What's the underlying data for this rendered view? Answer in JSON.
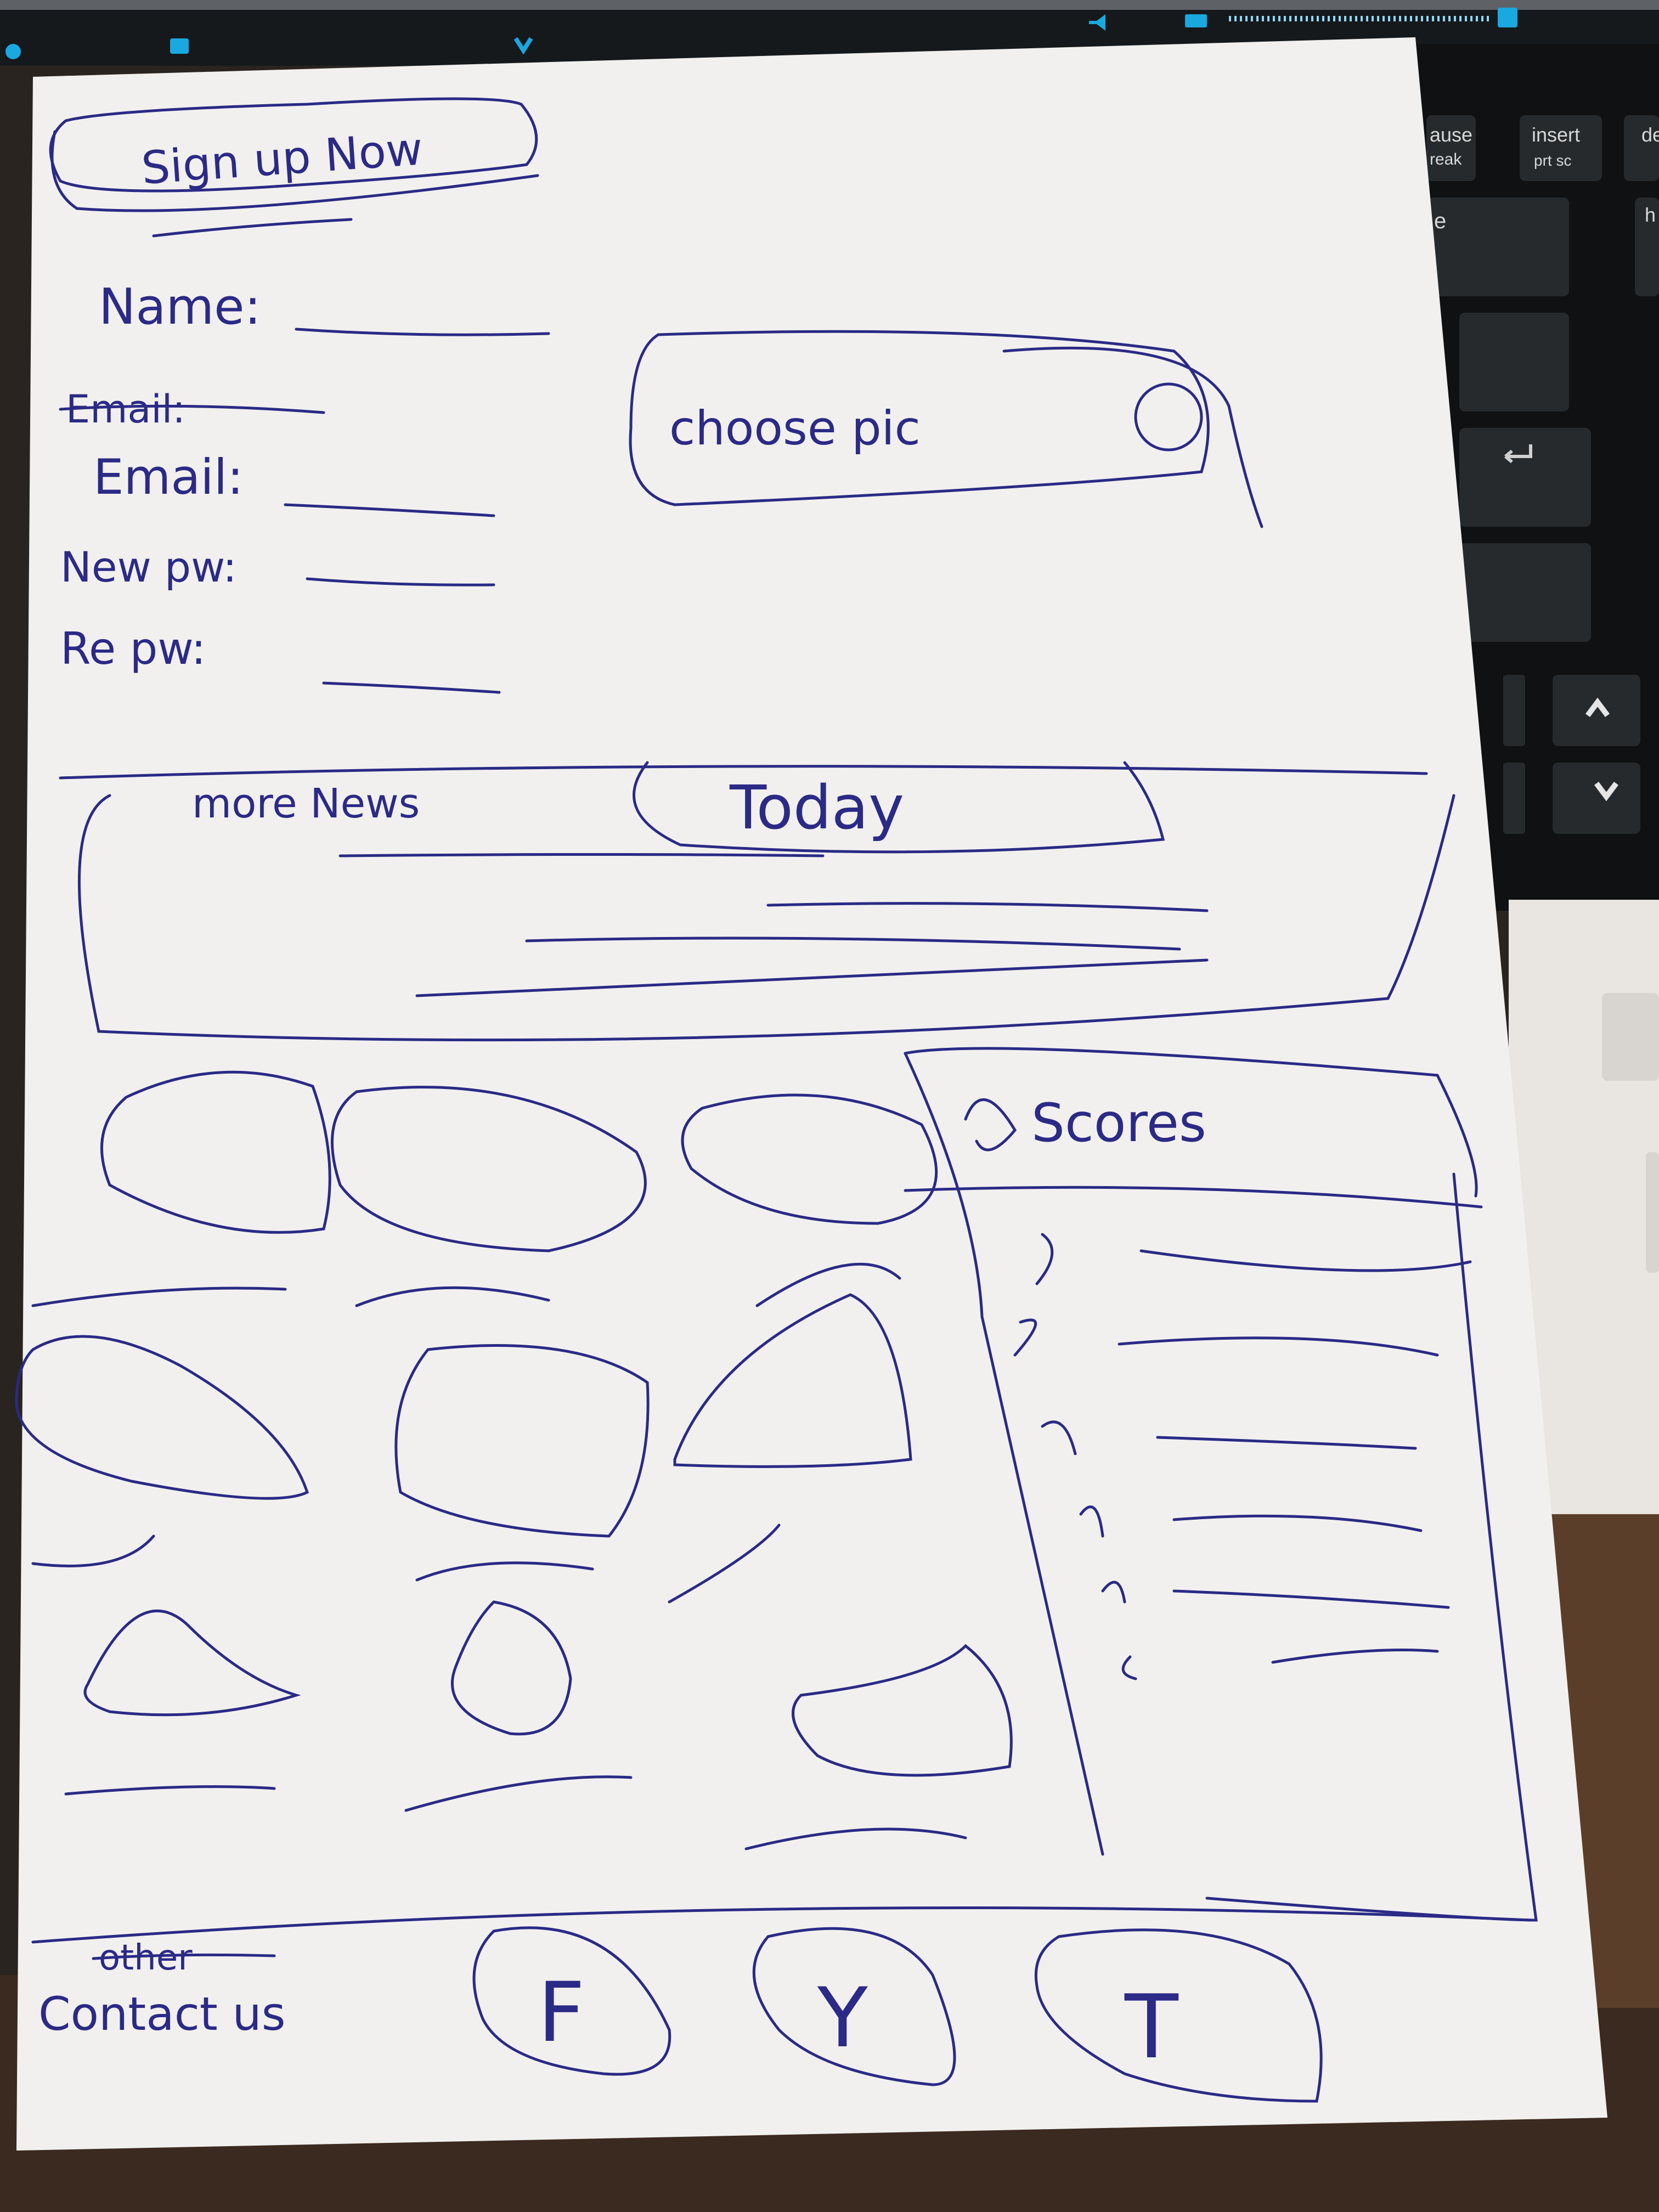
{
  "taskbar": {
    "icons": [
      "power-icon",
      "monitor-icon",
      "wifi-icon",
      "volume-icon",
      "battery-icon",
      "battery-meter-icon"
    ]
  },
  "keyboard": {
    "keys": [
      {
        "top": "ause",
        "bottom": "reak"
      },
      {
        "top": "insert",
        "bottom": "prt sc"
      },
      {
        "top": "de",
        "bottom": ""
      }
    ],
    "key_e": "e",
    "key_h": "h",
    "enter_icon": "enter-icon",
    "up_icon": "arrow-up-icon",
    "down_icon": "arrow-down-icon"
  },
  "sketch": {
    "signup_button": "Sign up Now",
    "fields": [
      {
        "label": "Name:"
      },
      {
        "label": "Email:",
        "crossed_out_label": "Email:"
      },
      {
        "label": "New pw:"
      },
      {
        "label": "Re pw:"
      }
    ],
    "choose_pic_button": "choose pic",
    "news": {
      "title": "more News",
      "tab": "Today"
    },
    "scores_title": "Scores",
    "footer": {
      "crossed_out": "other",
      "contact_label": "Contact us",
      "social_buttons": [
        "F",
        "Y",
        "T"
      ]
    }
  }
}
